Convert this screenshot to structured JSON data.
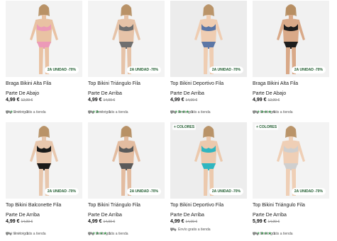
{
  "products": [
    {
      "name": "Braga Bikini Alta Fila",
      "sub": "Parte De Abajo",
      "price": "4,99 €",
      "old_price": "12,99 €",
      "rating": 2,
      "reviews": "2",
      "badge": "2A UNIDAD -70%",
      "shipping": "Envío gratis a tienda",
      "color_tag": "",
      "suit": "#ec9ab8",
      "skin": "#e9c2a3",
      "bg": "#f3f3f3"
    },
    {
      "name": "Top Bikini Triángulo Fila",
      "sub": "Parte De Arriba",
      "price": "4,99 €",
      "old_price": "14,99 €",
      "rating": 3,
      "reviews": "1",
      "badge": "2A UNIDAD -70%",
      "shipping": "Envío gratis a tienda",
      "color_tag": "",
      "suit": "#6f6f6f",
      "skin": "#e6c3a8",
      "bg": "#f3f3f3"
    },
    {
      "name": "Top Bikini Deportivo Fila",
      "sub": "Parte De Arriba",
      "price": "4,99 €",
      "old_price": "14,99 €",
      "rating": 5,
      "reviews": "3",
      "badge": "2A UNIDAD -70%",
      "shipping": "Envío gratis a tienda",
      "color_tag": "",
      "suit": "#5b76a6",
      "skin": "#efcdb2",
      "bg": "#ececec"
    },
    {
      "name": "Braga Bikini Alta Fila",
      "sub": "Parte De Abajo",
      "price": "4,99 €",
      "old_price": "12,99 €",
      "rating": 5,
      "reviews": "6",
      "badge": "2A UNIDAD -70%",
      "shipping": "Envío gratis a tienda",
      "color_tag": "",
      "suit": "#1d1d1d",
      "skin": "#d9a988",
      "bg": "#f1f1f1"
    },
    {
      "name": "Top Bikini Balconette Fila",
      "sub": "Parte De Arriba",
      "price": "4,99 €",
      "old_price": "14,99 €",
      "rating": 1,
      "reviews": "1",
      "badge": "2A UNIDAD -70%",
      "shipping": "Envío gratis a tienda",
      "color_tag": "",
      "suit": "#1a1a1a",
      "skin": "#e8c7ad",
      "bg": "#f3f3f3"
    },
    {
      "name": "Top Bikini Triángulo Fila",
      "sub": "Parte De Arriba",
      "price": "4,99 €",
      "old_price": "14,99 €",
      "rating": 5,
      "reviews": "1",
      "badge": "2A UNIDAD -70%",
      "shipping": "Envío gratis a tienda",
      "color_tag": "",
      "suit": "#5a5a5a",
      "skin": "#e3bca0",
      "bg": "#f2f2f2"
    },
    {
      "name": "Top Bikini Deportivo Fila",
      "sub": "Parte De Arriba",
      "price": "4,99 €",
      "old_price": "14,99 €",
      "rating": 0,
      "reviews": "",
      "badge": "2A UNIDAD -70%",
      "shipping": "Envío gratis a tienda",
      "color_tag": "+ COLORES",
      "suit": "#2fb6c0",
      "skin": "#ecc9ad",
      "bg": "#ededed"
    },
    {
      "name": "Top Bikini Triángulo Fila",
      "sub": "Parte De Arriba",
      "price": "5,99 €",
      "old_price": "14,99 €",
      "rating": 5,
      "reviews": "1",
      "badge": "2A UNIDAD -70%",
      "shipping": "Envío gratis a tienda",
      "color_tag": "+ COLORES",
      "suit": "#cfcfcf",
      "skin": "#efcfb6",
      "bg": "#f3f3f3"
    }
  ],
  "colors": {
    "accent": "#1c5a2c",
    "star": "#35a34b",
    "star_off": "#bbbbbb"
  }
}
